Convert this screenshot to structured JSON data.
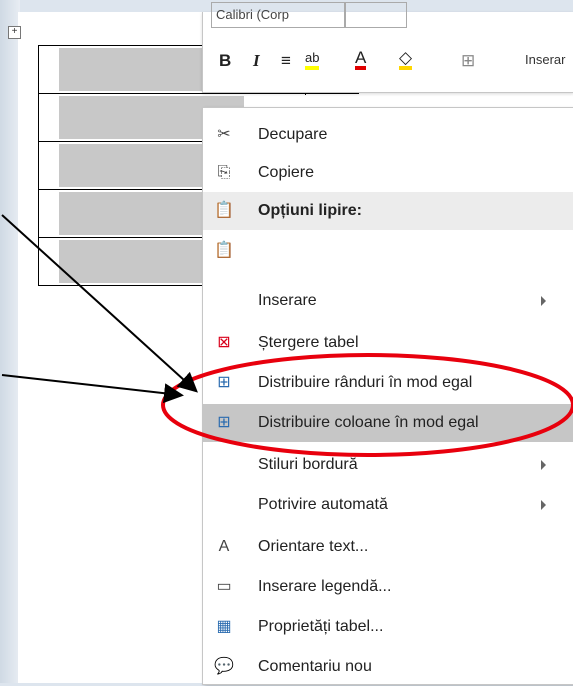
{
  "table": {
    "move_handle_glyph": "+"
  },
  "mini_toolbar": {
    "font_name": "Calibri (Corp",
    "bold": "B",
    "italic": "I",
    "align_glyph": "≡",
    "highlight_glyph": "ab",
    "font_color_glyph": "A",
    "shading_glyph": "◇",
    "borders_glyph": "⊞",
    "insert_label": "Inserar"
  },
  "context_menu": {
    "items": [
      {
        "label": "Decupare",
        "icon": "scissors-icon",
        "glyph": "✂",
        "underline_index": 3
      },
      {
        "label": "Copiere",
        "icon": "copy-icon",
        "glyph": "⎘"
      },
      {
        "label": "Opțiuni lipire:",
        "icon": "paste-icon",
        "glyph": "📋",
        "header": true
      },
      {
        "label": "",
        "icon": "paste-option-icon",
        "glyph": "📋"
      },
      {
        "label": "Inserare",
        "icon": "",
        "glyph": "",
        "submenu": true
      },
      {
        "label": "Ștergere tabel",
        "icon": "delete-table-icon",
        "glyph": "⊠"
      },
      {
        "label": "Distribuire rânduri în mod egal",
        "icon": "distribute-rows-icon",
        "glyph": "⊞"
      },
      {
        "label": "Distribuire coloane în mod egal",
        "icon": "distribute-columns-icon",
        "glyph": "⊞",
        "highlighted": true
      },
      {
        "label": "Stiluri bordură",
        "icon": "",
        "glyph": "",
        "submenu": true
      },
      {
        "label": "Potrivire automată",
        "icon": "",
        "glyph": "",
        "submenu": true
      },
      {
        "label": "Orientare text...",
        "icon": "text-direction-icon",
        "glyph": "A"
      },
      {
        "label": "Inserare legendă...",
        "icon": "insert-caption-icon",
        "glyph": "▭"
      },
      {
        "label": "Proprietăți tabel...",
        "icon": "table-properties-icon",
        "glyph": "▦"
      },
      {
        "label": "Comentariu nou",
        "icon": "new-comment-icon",
        "glyph": "💬"
      }
    ]
  },
  "annotation": {
    "ellipse_color": "#e8000d",
    "arrow_color": "#000000"
  }
}
